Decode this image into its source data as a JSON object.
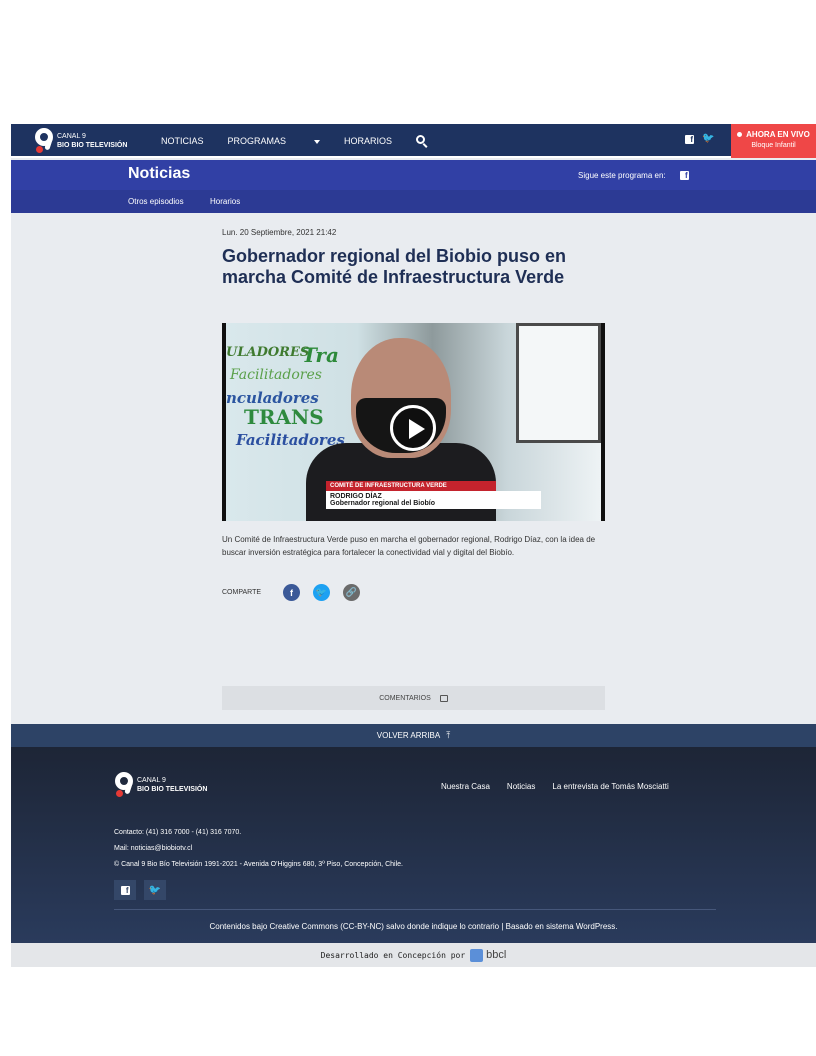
{
  "brand": {
    "logo_line1": "CANAL 9",
    "logo_line2": "BIO BIO TELEVISIÓN"
  },
  "nav": {
    "items": [
      "NOTICIAS",
      "PROGRAMAS",
      "HORARIOS"
    ]
  },
  "live": {
    "label": "AHORA EN VIVO",
    "program": "Bloque Infantil"
  },
  "program": {
    "title": "Noticias",
    "follow_label": "Sigue este programa en:",
    "subnav": [
      "Otros episodios",
      "Horarios"
    ]
  },
  "article": {
    "date": "Lun. 20 Septiembre, 2021 21:42",
    "headline": "Gobernador regional del Biobio puso en marcha Comité de Infraestructura Verde",
    "excerpt": "Un Comité de Infraestructura Verde puso en marcha el gobernador regional, Rodrigo Díaz, con la idea de buscar inversión estratégica para fortalecer la conectividad vial y digital del Biobío.",
    "share_label": "COMPARTE",
    "comments_label": "COMENTARIOS"
  },
  "video": {
    "bg_words": [
      "ULADORES",
      "Tra",
      "Facilitadores",
      "nculadores",
      "TRANS",
      "Facilitadores"
    ],
    "lower_third_title": "COMITÉ DE INFRAESTRUCTURA VERDE",
    "lower_third_name": "RODRIGO DÍAZ",
    "lower_third_role": "Gobernador regional del Biobío"
  },
  "footer": {
    "back_to_top": "VOLVER ARRIBA",
    "links": [
      "Nuestra Casa",
      "Noticias",
      "La entrevista de Tomás Mosciatti"
    ],
    "contact": "Contacto: (41) 316 7000 - (41) 316 7070.",
    "mail": "Mail: noticias@biobiotv.cl",
    "copyright": "© Canal 9 Bio Bío Televisión 1991-2021 - Avenida O'Higgins 680, 3º Piso, Concepción, Chile.",
    "license": "Contenidos bajo Creative Commons (CC-BY-NC) salvo donde indique lo contrario | Basado en sistema WordPress.",
    "developed": "Desarrollado en Concepción por",
    "dev_brand": "bbcl"
  },
  "colors": {
    "nav": "#1e3360",
    "program_band": "#3140a5",
    "live": "#ef4747",
    "footer": "#1d2536"
  }
}
